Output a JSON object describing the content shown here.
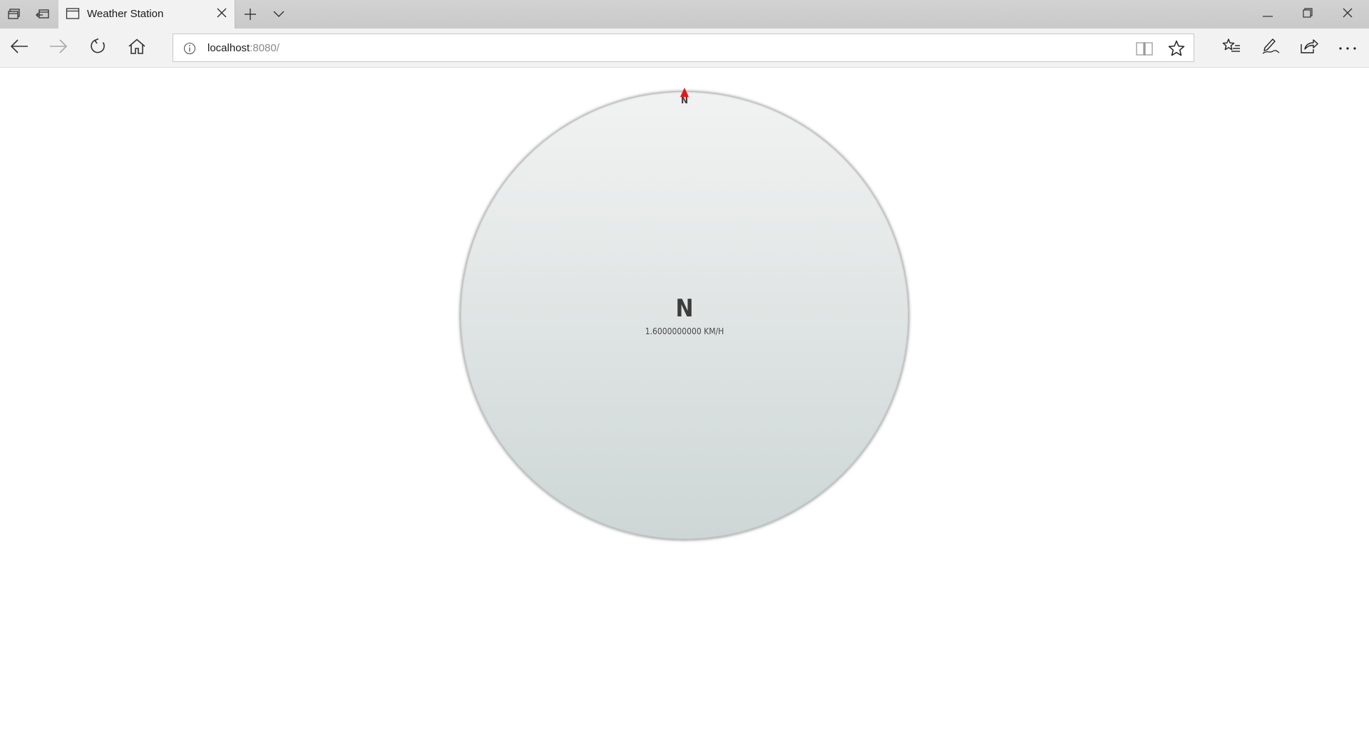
{
  "browser": {
    "tab": {
      "title": "Weather Station"
    },
    "address": {
      "host": "localhost",
      "rest": ":8080/"
    },
    "icons": {
      "tab_preview": "tab-preview-icon",
      "set_aside": "set-aside-tabs-icon",
      "new_tab": "plus-icon",
      "tab_list": "chevron-down-icon",
      "back": "back-arrow-icon",
      "forward": "forward-arrow-icon",
      "refresh": "refresh-icon",
      "home": "home-icon",
      "info": "info-icon",
      "reading_view": "book-icon",
      "favorite": "star-icon",
      "favorites_hub": "favorites-list-icon",
      "notes": "pen-icon",
      "share": "share-icon",
      "more": "more-icon"
    }
  },
  "compass": {
    "marker_label": "N",
    "direction": "N",
    "speed_text": "1.6000000000 KM/H",
    "needle_color": "#e8161a"
  }
}
